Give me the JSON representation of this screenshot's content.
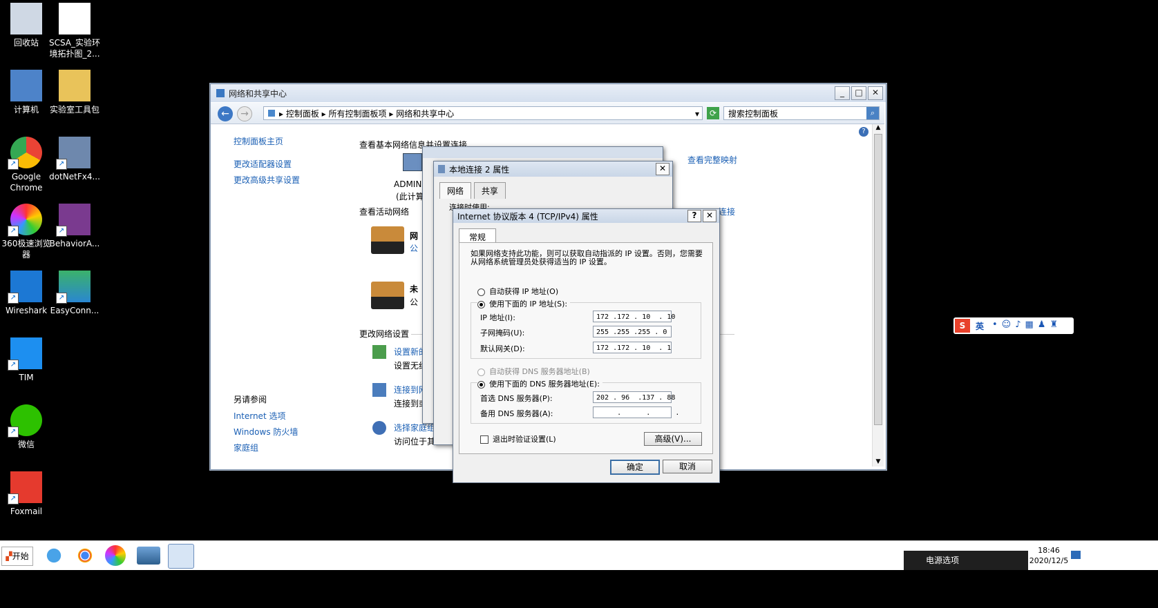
{
  "desktop": {
    "icons": [
      {
        "label": "回收站",
        "icon": "recycle-bin-icon"
      },
      {
        "label": "SCSA_实验环境拓扑图_2...",
        "icon": "image-file-icon"
      },
      {
        "label": "计算机",
        "icon": "computer-icon"
      },
      {
        "label": "实验室工具包",
        "icon": "folder-icon"
      },
      {
        "label": "Google Chrome",
        "icon": "chrome-icon"
      },
      {
        "label": "dotNetFx4...",
        "icon": "installer-icon"
      },
      {
        "label": "360极速浏览器",
        "icon": "360-browser-icon"
      },
      {
        "label": "BehaviorA...",
        "icon": "winrar-icon"
      },
      {
        "label": "Wireshark",
        "icon": "wireshark-icon"
      },
      {
        "label": "EasyConn...",
        "icon": "easyconnect-icon"
      },
      {
        "label": "TIM",
        "icon": "tim-icon"
      },
      {
        "label": "微信",
        "icon": "wechat-icon"
      },
      {
        "label": "Foxmail",
        "icon": "foxmail-icon"
      }
    ]
  },
  "main_window": {
    "title": "网络和共享中心",
    "breadcrumb": [
      "控制面板",
      "所有控制面板项",
      "网络和共享中心"
    ],
    "search_placeholder": "搜索控制面板",
    "sidebar": {
      "home": "控制面板主页",
      "links": [
        "更改适配器设置",
        "更改高级共享设置"
      ],
      "see_also_title": "另请参阅",
      "see_also": [
        "Internet 选项",
        "Windows 防火墙",
        "家庭组"
      ]
    },
    "content": {
      "heading": "查看基本网络信息并设置连接",
      "view_full_map": "查看完整映射",
      "pc_name": "ADMIN",
      "pc_sub": "(此计算",
      "active_networks": "查看活动网络",
      "net1_name": "网",
      "net1_type": "公",
      "net2_name": "未",
      "net2_type": "公",
      "connect_tail": "连接",
      "change_settings": "更改网络设置",
      "tasks": [
        {
          "link": "设置新的",
          "desc": "设置无线"
        },
        {
          "link": "连接到网",
          "desc": "连接到或"
        },
        {
          "link": "选择家庭组",
          "desc": "访问位于其他"
        }
      ]
    }
  },
  "conn_dialog": {
    "title": "本地连接 2 属性",
    "tabs": [
      "网络",
      "共享"
    ],
    "conn_label": "连接时使用:"
  },
  "ipv4_dialog": {
    "title": "Internet 协议版本 4 (TCP/IPv4) 属性",
    "help": "?",
    "tab": "常规",
    "desc": "如果网络支持此功能，则可以获取自动指派的 IP 设置。否则，您需要从网络系统管理员处获得适当的 IP 设置。",
    "auto_ip": "自动获得 IP 地址(O)",
    "manual_ip": "使用下面的 IP 地址(S):",
    "ip_label": "IP 地址(I):",
    "ip_value": "172 .172 . 10  . 10",
    "mask_label": "子网掩码(U):",
    "mask_value": "255 .255 .255 . 0",
    "gw_label": "默认网关(D):",
    "gw_value": "172 .172 . 10  . 1",
    "auto_dns": "自动获得 DNS 服务器地址(B)",
    "manual_dns": "使用下面的 DNS 服务器地址(E):",
    "dns1_label": "首选 DNS 服务器(P):",
    "dns1_value": "202 . 96  .137 . 88",
    "dns2_label": "备用 DNS 服务器(A):",
    "dns2_value": "     .      .      .",
    "validate": "退出时验证设置(L)",
    "advanced": "高级(V)...",
    "ok": "确定",
    "cancel": "取消"
  },
  "ime": {
    "lang": "英"
  },
  "taskbar": {
    "start": "开始",
    "tray_popup": "电源选项",
    "time": "18:46",
    "date": "2020/12/5"
  }
}
